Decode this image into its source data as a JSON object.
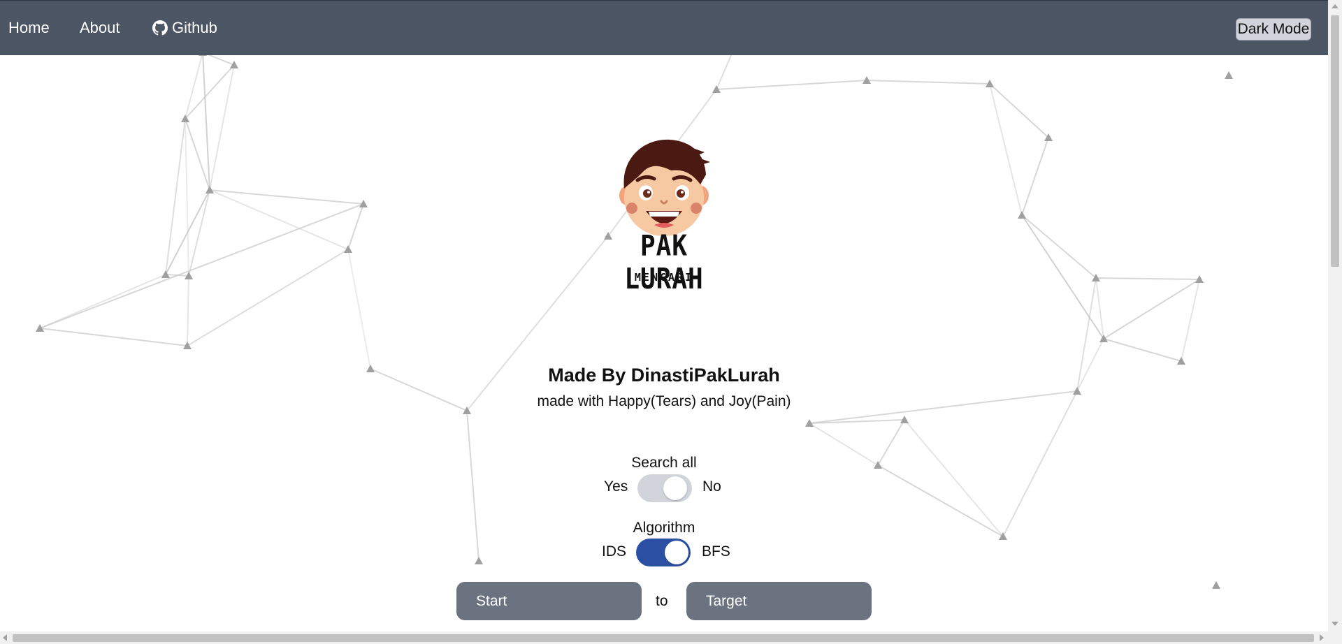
{
  "nav": {
    "home": "Home",
    "about": "About",
    "github": "Github",
    "github_icon": "github-icon",
    "dark_mode": "Dark Mode"
  },
  "logo": {
    "title": "PAK LURAH",
    "subtitle": "MENCARI",
    "icon": "boy-face-icon"
  },
  "credits": {
    "made_by": "Made By DinastiPakLurah",
    "made_with": "made with Happy(Tears) and Joy(Pain)"
  },
  "search_all": {
    "label": "Search all",
    "left": "Yes",
    "right": "No",
    "state": "off",
    "track_color": "#d1d5db"
  },
  "algorithm": {
    "label": "Algorithm",
    "left": "IDS",
    "right": "BFS",
    "state": "on",
    "track_color": "#2b4fa3"
  },
  "inputs": {
    "start_placeholder": "Start",
    "connector": "to",
    "target_placeholder": "Target"
  },
  "colors": {
    "navbar": "#4b5563",
    "pill": "#6b7280",
    "network_line": "#c8c8c8",
    "network_node": "#a0a0a0"
  }
}
